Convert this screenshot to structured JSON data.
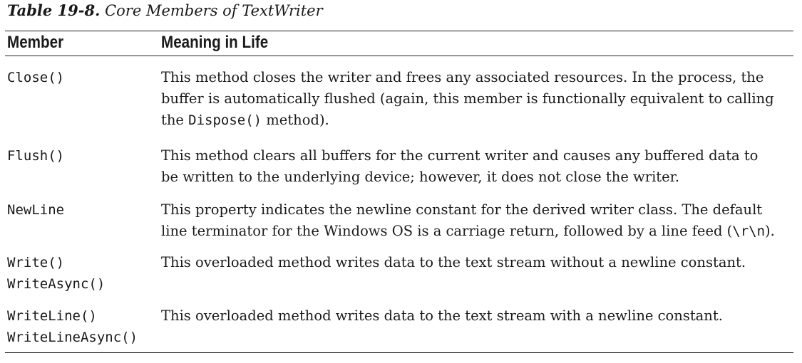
{
  "caption": {
    "number": "Table 19-8.",
    "title": "Core Members of TextWriter"
  },
  "columns": {
    "member": "Member",
    "meaning": "Meaning in Life"
  },
  "rows": [
    {
      "members": [
        "Close()"
      ],
      "lines": [
        "This method closes the writer and frees any associated resources. In the process, the",
        "buffer is automatically flushed (again, this member is functionally equivalent to calling"
      ],
      "last_prefix": "the ",
      "last_code": "Dispose()",
      "last_suffix": " method)."
    },
    {
      "members": [
        "Flush()"
      ],
      "lines": [
        "This method clears all buffers for the current writer and causes any buffered data to",
        "be written to the underlying device; however, it does not close the writer."
      ]
    },
    {
      "members": [
        "NewLine"
      ],
      "lines": [
        "This property indicates the newline constant for the derived writer class. The default"
      ],
      "last_prefix": "line terminator for the Windows OS is a carriage return, followed by a line feed (",
      "last_code": "\\r\\n",
      "last_suffix": ")."
    },
    {
      "members": [
        "Write()",
        "WriteAsync()"
      ],
      "lines": [
        "This overloaded method writes data to the text stream without a newline constant."
      ]
    },
    {
      "members": [
        "WriteLine()",
        "WriteLineAsync()"
      ],
      "lines": [
        "This overloaded method writes data to the text stream with a newline constant."
      ]
    }
  ]
}
